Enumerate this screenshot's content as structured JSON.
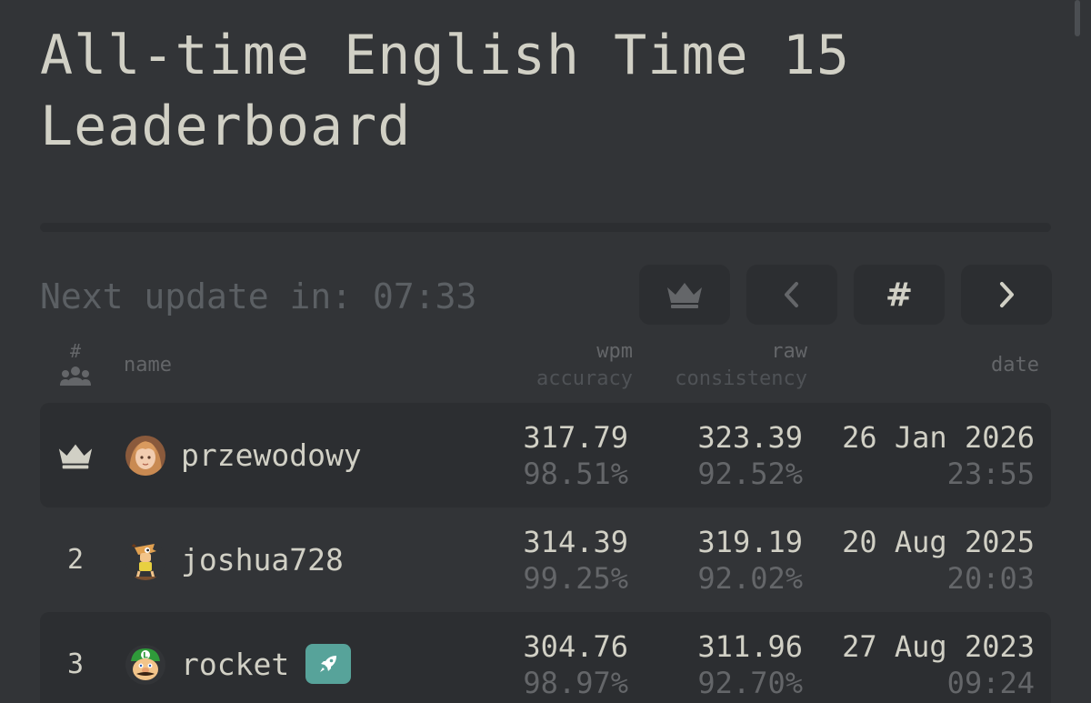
{
  "title": "All-time English Time 15 Leaderboard",
  "next_update": "Next update in: 07:33",
  "controls": {
    "first_icon": "crown-icon",
    "prev_icon": "chevron-left-icon",
    "jump_label": "#",
    "next_icon": "chevron-right-icon"
  },
  "columns": {
    "rank": "#",
    "rank_icon": "users-icon",
    "name": "name",
    "wpm": "wpm",
    "accuracy": "accuracy",
    "raw": "raw",
    "consistency": "consistency",
    "date": "date"
  },
  "rows": [
    {
      "rank": "",
      "rank_icon": "crown-icon",
      "name": "przewodowy",
      "wpm": "317.79",
      "accuracy": "98.51%",
      "raw": "323.39",
      "consistency": "92.52%",
      "date": "26 Jan 2026",
      "time": "23:55"
    },
    {
      "rank": "2",
      "name": "joshua728",
      "wpm": "314.39",
      "accuracy": "99.25%",
      "raw": "319.19",
      "consistency": "92.02%",
      "date": "20 Aug 2025",
      "time": "20:03"
    },
    {
      "rank": "3",
      "name": "rocket",
      "badge_icon": "rocket-icon",
      "wpm": "304.76",
      "accuracy": "98.97%",
      "raw": "311.96",
      "consistency": "92.70%",
      "date": "27 Aug 2023",
      "time": "09:24"
    }
  ],
  "colors": {
    "background": "#323437",
    "row_alt": "#2c2e31",
    "text": "#d1d0c5",
    "muted": "#646669",
    "badge": "#57a39a"
  }
}
